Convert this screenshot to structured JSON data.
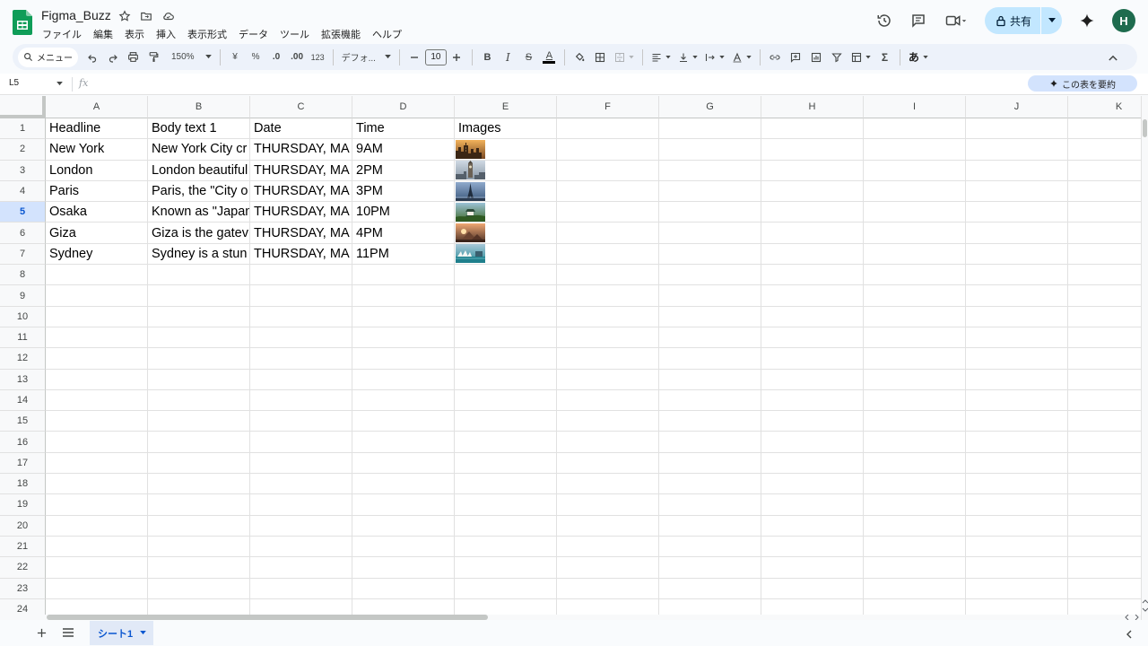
{
  "document": {
    "title": "Figma_Buzz"
  },
  "menubar": [
    "ファイル",
    "編集",
    "表示",
    "挿入",
    "表示形式",
    "データ",
    "ツール",
    "拡張機能",
    "ヘルプ"
  ],
  "share": {
    "label": "共有"
  },
  "avatar": {
    "initial": "H"
  },
  "toolbar": {
    "menu_search": "メニュー",
    "zoom": "150%",
    "currency": "¥",
    "percent": "%",
    "decrease_decimal": ".0",
    "increase_decimal": ".00",
    "number_format": "123",
    "font": "デフォ...",
    "font_size": "10",
    "bold": "B",
    "italic": "I",
    "strike": "S",
    "text_color": "A",
    "sum": "Σ",
    "input_tools": "あ"
  },
  "formula_bar": {
    "name_box": "L5",
    "fx": "fx",
    "summarize_label": "この表を要約"
  },
  "grid": {
    "columns": [
      "A",
      "B",
      "C",
      "D",
      "E",
      "F",
      "G",
      "H",
      "I",
      "J",
      "K"
    ],
    "active_row": 5,
    "row_numbers": [
      "1",
      "2",
      "3",
      "4",
      "5",
      "6",
      "7",
      "8",
      "9",
      "10",
      "11",
      "12",
      "13",
      "14",
      "15",
      "16",
      "17",
      "18",
      "19",
      "20",
      "21",
      "22",
      "23",
      "24"
    ],
    "header_row": [
      "Headline",
      "Body text 1",
      "Date",
      "Time",
      "Images"
    ],
    "data_rows": [
      {
        "headline": "New York",
        "body": "New York City cr",
        "date": "THURSDAY, MA",
        "time": "9AM",
        "image": "new-york-thumbnail"
      },
      {
        "headline": "London",
        "body": "London beautiful",
        "date": "THURSDAY, MA",
        "time": "2PM",
        "image": "london-thumbnail"
      },
      {
        "headline": "Paris",
        "body": "Paris, the \"City o",
        "date": "THURSDAY, MA",
        "time": "3PM",
        "image": "paris-thumbnail"
      },
      {
        "headline": "Osaka",
        "body": "Known as \"Japan",
        "date": "THURSDAY, MA",
        "time": "10PM",
        "image": "osaka-thumbnail"
      },
      {
        "headline": "Giza",
        "body": "Giza is the gatev",
        "date": "THURSDAY, MA",
        "time": "4PM",
        "image": "giza-thumbnail"
      },
      {
        "headline": "Sydney",
        "body": "Sydney is a stun",
        "date": "THURSDAY, MA",
        "time": "11PM",
        "image": "sydney-thumbnail"
      }
    ]
  },
  "sheets": {
    "tabs": [
      "シート1"
    ]
  },
  "colors": {
    "accent": "#0b57d0",
    "share_bg": "#c2e7ff",
    "avatar_bg": "#1e6b4e",
    "logo": "#0f9d58"
  }
}
